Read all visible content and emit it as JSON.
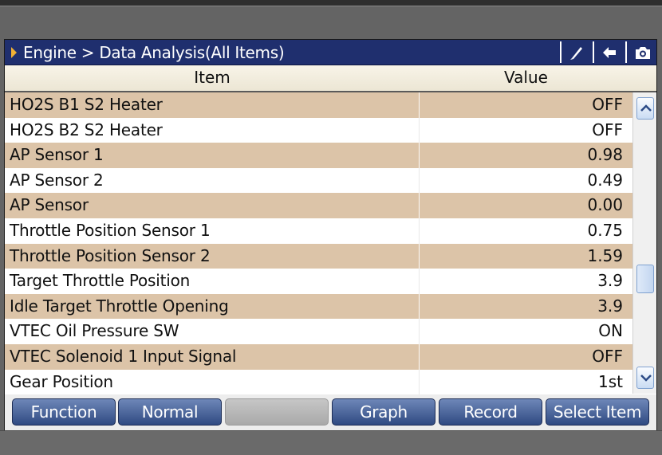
{
  "titlebar": {
    "breadcrumb": "Engine > Data Analysis(All Items)",
    "buttons": [
      {
        "icon": "pen-icon"
      },
      {
        "icon": "back-arrow-icon"
      },
      {
        "icon": "camera-icon"
      }
    ]
  },
  "table": {
    "headers": {
      "item": "Item",
      "value": "Value"
    },
    "rows": [
      {
        "item": "HO2S B1 S2 Heater",
        "value": "OFF"
      },
      {
        "item": "HO2S B2 S2 Heater",
        "value": "OFF"
      },
      {
        "item": "AP Sensor 1",
        "value": "0.98"
      },
      {
        "item": "AP Sensor 2",
        "value": "0.49"
      },
      {
        "item": "AP Sensor",
        "value": "0.00"
      },
      {
        "item": "Throttle Position Sensor 1",
        "value": "0.75"
      },
      {
        "item": "Throttle Position Sensor 2",
        "value": "1.59"
      },
      {
        "item": "Target Throttle Position",
        "value": "3.9"
      },
      {
        "item": "Idle Target Throttle Opening",
        "value": "3.9"
      },
      {
        "item": "VTEC Oil Pressure SW",
        "value": "ON"
      },
      {
        "item": "VTEC Solenoid 1 Input Signal",
        "value": "OFF"
      },
      {
        "item": "Gear Position",
        "value": "1st"
      }
    ]
  },
  "buttons": {
    "function": "Function",
    "normal": "Normal",
    "blank": "",
    "graph": "Graph",
    "record": "Record",
    "select_item": "Select Item"
  },
  "colors": {
    "titlebar": "#1f2f6e",
    "row_shaded": "#dcc4a8",
    "button": "#3f5a93",
    "accent_arrow": "#f2b134"
  }
}
